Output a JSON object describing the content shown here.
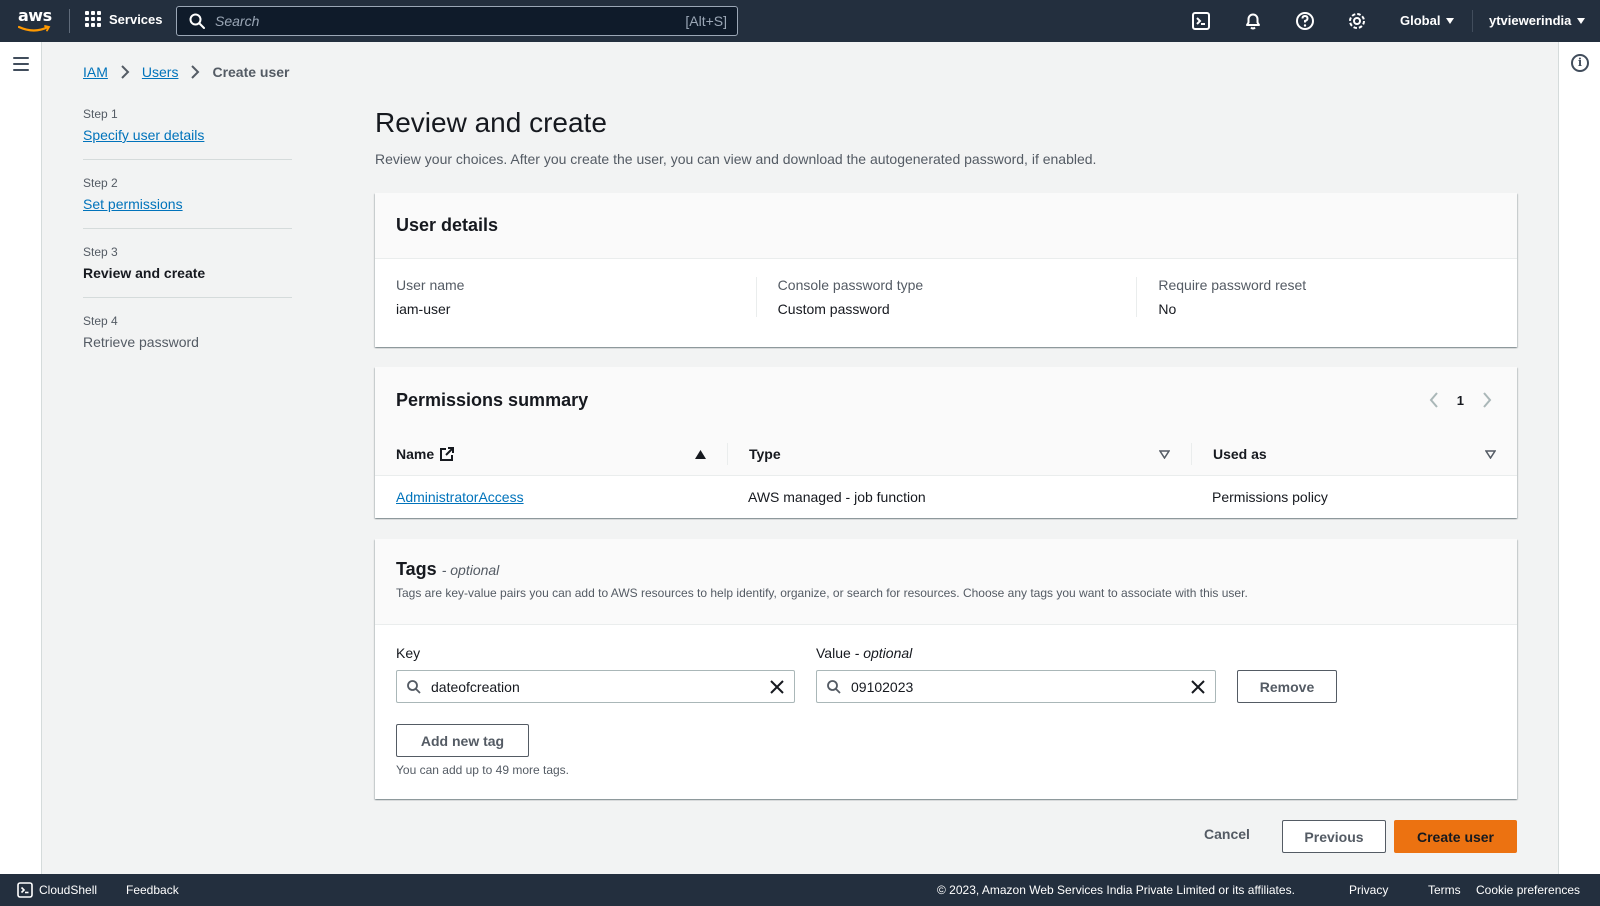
{
  "topnav": {
    "logo_text": "aws",
    "services_label": "Services",
    "search_placeholder": "Search",
    "search_shortcut": "[Alt+S]",
    "region_label": "Global",
    "account_label": "ytviewerindia"
  },
  "breadcrumb": {
    "items": [
      "IAM",
      "Users"
    ],
    "current": "Create user"
  },
  "wizard": {
    "steps": [
      {
        "number": "Step 1",
        "label": "Specify user details"
      },
      {
        "number": "Step 2",
        "label": "Set permissions"
      },
      {
        "number": "Step 3",
        "label": "Review and create"
      },
      {
        "number": "Step 4",
        "label": "Retrieve password"
      }
    ]
  },
  "page": {
    "title": "Review and create",
    "description": "Review your choices. After you create the user, you can view and download the autogenerated password, if enabled."
  },
  "user_details": {
    "title": "User details",
    "fields": [
      {
        "label": "User name",
        "value": "iam-user"
      },
      {
        "label": "Console password type",
        "value": "Custom password"
      },
      {
        "label": "Require password reset",
        "value": "No"
      }
    ]
  },
  "permissions": {
    "title": "Permissions summary",
    "page": "1",
    "columns": [
      "Name",
      "Type",
      "Used as"
    ],
    "rows": [
      {
        "name": "AdministratorAccess",
        "type": "AWS managed - job function",
        "used_as": "Permissions policy"
      }
    ]
  },
  "tags": {
    "title": "Tags",
    "title_suffix": "- optional",
    "description": "Tags are key-value pairs you can add to AWS resources to help identify, organize, or search for resources. Choose any tags you want to associate with this user.",
    "key_label": "Key",
    "value_label": "Value",
    "value_label_suffix": "- optional",
    "key_value": "dateofcreation",
    "value_value": "09102023",
    "remove_label": "Remove",
    "add_label": "Add new tag",
    "hint": "You can add up to 49 more tags."
  },
  "actions": {
    "cancel": "Cancel",
    "previous": "Previous",
    "create": "Create user"
  },
  "footer": {
    "cloudshell": "CloudShell",
    "feedback": "Feedback",
    "copyright": "© 2023, Amazon Web Services India Private Limited or its affiliates.",
    "privacy": "Privacy",
    "terms": "Terms",
    "cookies": "Cookie preferences"
  },
  "colors": {
    "nav_bg": "#232f3e",
    "link": "#0073bb",
    "primary_button": "#ec7211"
  }
}
